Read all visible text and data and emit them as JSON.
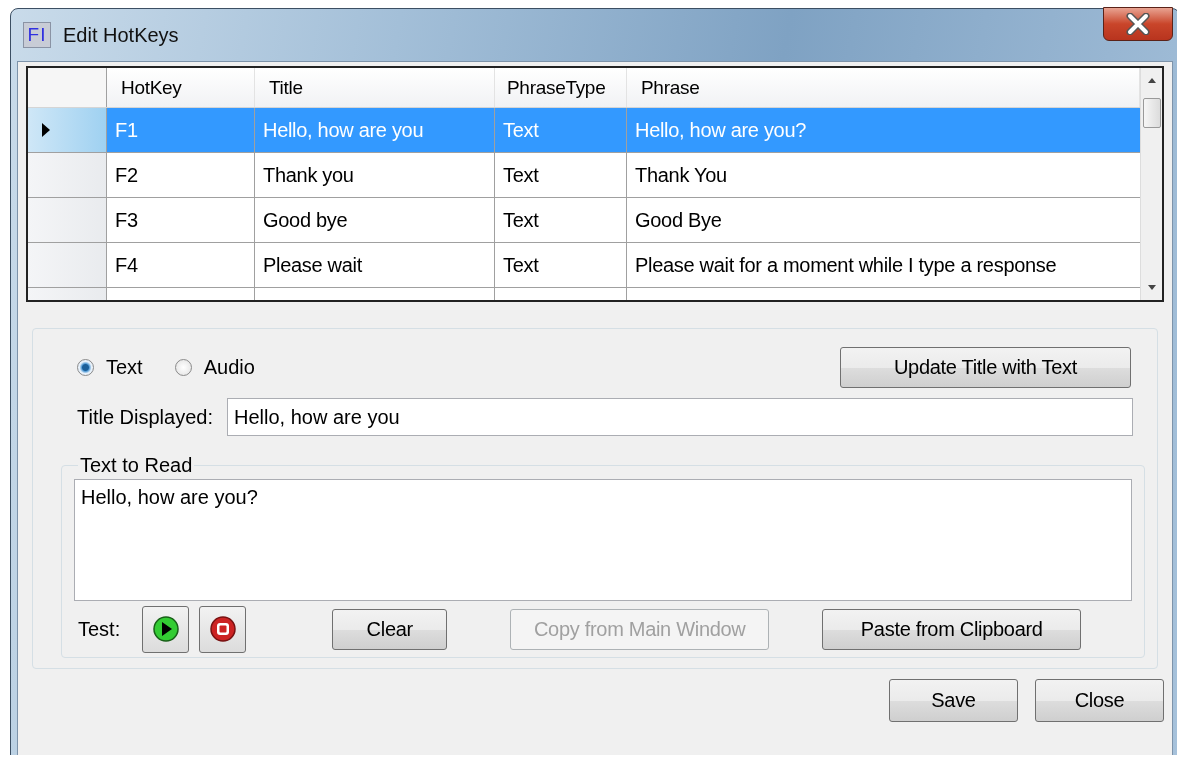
{
  "window": {
    "title": "Edit HotKeys",
    "app_badge": "FI"
  },
  "grid": {
    "columns": [
      "HotKey",
      "Title",
      "PhraseType",
      "Phrase"
    ],
    "rows": [
      {
        "cells": [
          "F1",
          "Hello, how are you",
          "Text",
          "Hello, how are you?"
        ],
        "selected": true,
        "current": true
      },
      {
        "cells": [
          "F2",
          "Thank you",
          "Text",
          "Thank You"
        ],
        "selected": false,
        "current": false
      },
      {
        "cells": [
          "F3",
          "Good bye",
          "Text",
          "Good Bye"
        ],
        "selected": false,
        "current": false
      },
      {
        "cells": [
          "F4",
          "Please wait",
          "Text",
          "Please wait for a moment while I type a response"
        ],
        "selected": false,
        "current": false
      }
    ]
  },
  "mode_options": [
    {
      "label": "Text",
      "selected": true
    },
    {
      "label": "Audio",
      "selected": false
    }
  ],
  "update_button": {
    "label": "Update Title with Text",
    "disabled": false
  },
  "title_field": {
    "label": "Title Displayed:",
    "value": "Hello, how are you"
  },
  "text_group": {
    "title": "Text to Read",
    "value": "Hello, how are you?"
  },
  "test": {
    "label": "Test:"
  },
  "action_buttons": [
    {
      "label": "Clear",
      "disabled": false
    },
    {
      "label": "Copy from Main Window",
      "disabled": true
    },
    {
      "label": "Paste from Clipboard",
      "disabled": false
    }
  ],
  "footer_buttons": [
    {
      "label": "Save",
      "disabled": false
    },
    {
      "label": "Close",
      "disabled": false
    }
  ]
}
